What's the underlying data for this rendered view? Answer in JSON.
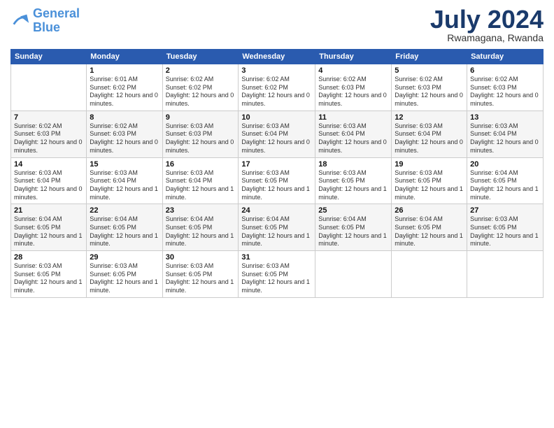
{
  "logo": {
    "line1": "General",
    "line2": "Blue"
  },
  "title": "July 2024",
  "subtitle": "Rwamagana, Rwanda",
  "days_header": [
    "Sunday",
    "Monday",
    "Tuesday",
    "Wednesday",
    "Thursday",
    "Friday",
    "Saturday"
  ],
  "weeks": [
    [
      {
        "day": "",
        "sunrise": "",
        "sunset": "",
        "daylight": ""
      },
      {
        "day": "1",
        "sunrise": "Sunrise: 6:01 AM",
        "sunset": "Sunset: 6:02 PM",
        "daylight": "Daylight: 12 hours and 0 minutes."
      },
      {
        "day": "2",
        "sunrise": "Sunrise: 6:02 AM",
        "sunset": "Sunset: 6:02 PM",
        "daylight": "Daylight: 12 hours and 0 minutes."
      },
      {
        "day": "3",
        "sunrise": "Sunrise: 6:02 AM",
        "sunset": "Sunset: 6:02 PM",
        "daylight": "Daylight: 12 hours and 0 minutes."
      },
      {
        "day": "4",
        "sunrise": "Sunrise: 6:02 AM",
        "sunset": "Sunset: 6:03 PM",
        "daylight": "Daylight: 12 hours and 0 minutes."
      },
      {
        "day": "5",
        "sunrise": "Sunrise: 6:02 AM",
        "sunset": "Sunset: 6:03 PM",
        "daylight": "Daylight: 12 hours and 0 minutes."
      },
      {
        "day": "6",
        "sunrise": "Sunrise: 6:02 AM",
        "sunset": "Sunset: 6:03 PM",
        "daylight": "Daylight: 12 hours and 0 minutes."
      }
    ],
    [
      {
        "day": "7",
        "sunrise": "Sunrise: 6:02 AM",
        "sunset": "Sunset: 6:03 PM",
        "daylight": "Daylight: 12 hours and 0 minutes."
      },
      {
        "day": "8",
        "sunrise": "Sunrise: 6:02 AM",
        "sunset": "Sunset: 6:03 PM",
        "daylight": "Daylight: 12 hours and 0 minutes."
      },
      {
        "day": "9",
        "sunrise": "Sunrise: 6:03 AM",
        "sunset": "Sunset: 6:03 PM",
        "daylight": "Daylight: 12 hours and 0 minutes."
      },
      {
        "day": "10",
        "sunrise": "Sunrise: 6:03 AM",
        "sunset": "Sunset: 6:04 PM",
        "daylight": "Daylight: 12 hours and 0 minutes."
      },
      {
        "day": "11",
        "sunrise": "Sunrise: 6:03 AM",
        "sunset": "Sunset: 6:04 PM",
        "daylight": "Daylight: 12 hours and 0 minutes."
      },
      {
        "day": "12",
        "sunrise": "Sunrise: 6:03 AM",
        "sunset": "Sunset: 6:04 PM",
        "daylight": "Daylight: 12 hours and 0 minutes."
      },
      {
        "day": "13",
        "sunrise": "Sunrise: 6:03 AM",
        "sunset": "Sunset: 6:04 PM",
        "daylight": "Daylight: 12 hours and 0 minutes."
      }
    ],
    [
      {
        "day": "14",
        "sunrise": "Sunrise: 6:03 AM",
        "sunset": "Sunset: 6:04 PM",
        "daylight": "Daylight: 12 hours and 0 minutes."
      },
      {
        "day": "15",
        "sunrise": "Sunrise: 6:03 AM",
        "sunset": "Sunset: 6:04 PM",
        "daylight": "Daylight: 12 hours and 1 minute."
      },
      {
        "day": "16",
        "sunrise": "Sunrise: 6:03 AM",
        "sunset": "Sunset: 6:04 PM",
        "daylight": "Daylight: 12 hours and 1 minute."
      },
      {
        "day": "17",
        "sunrise": "Sunrise: 6:03 AM",
        "sunset": "Sunset: 6:05 PM",
        "daylight": "Daylight: 12 hours and 1 minute."
      },
      {
        "day": "18",
        "sunrise": "Sunrise: 6:03 AM",
        "sunset": "Sunset: 6:05 PM",
        "daylight": "Daylight: 12 hours and 1 minute."
      },
      {
        "day": "19",
        "sunrise": "Sunrise: 6:03 AM",
        "sunset": "Sunset: 6:05 PM",
        "daylight": "Daylight: 12 hours and 1 minute."
      },
      {
        "day": "20",
        "sunrise": "Sunrise: 6:04 AM",
        "sunset": "Sunset: 6:05 PM",
        "daylight": "Daylight: 12 hours and 1 minute."
      }
    ],
    [
      {
        "day": "21",
        "sunrise": "Sunrise: 6:04 AM",
        "sunset": "Sunset: 6:05 PM",
        "daylight": "Daylight: 12 hours and 1 minute."
      },
      {
        "day": "22",
        "sunrise": "Sunrise: 6:04 AM",
        "sunset": "Sunset: 6:05 PM",
        "daylight": "Daylight: 12 hours and 1 minute."
      },
      {
        "day": "23",
        "sunrise": "Sunrise: 6:04 AM",
        "sunset": "Sunset: 6:05 PM",
        "daylight": "Daylight: 12 hours and 1 minute."
      },
      {
        "day": "24",
        "sunrise": "Sunrise: 6:04 AM",
        "sunset": "Sunset: 6:05 PM",
        "daylight": "Daylight: 12 hours and 1 minute."
      },
      {
        "day": "25",
        "sunrise": "Sunrise: 6:04 AM",
        "sunset": "Sunset: 6:05 PM",
        "daylight": "Daylight: 12 hours and 1 minute."
      },
      {
        "day": "26",
        "sunrise": "Sunrise: 6:04 AM",
        "sunset": "Sunset: 6:05 PM",
        "daylight": "Daylight: 12 hours and 1 minute."
      },
      {
        "day": "27",
        "sunrise": "Sunrise: 6:03 AM",
        "sunset": "Sunset: 6:05 PM",
        "daylight": "Daylight: 12 hours and 1 minute."
      }
    ],
    [
      {
        "day": "28",
        "sunrise": "Sunrise: 6:03 AM",
        "sunset": "Sunset: 6:05 PM",
        "daylight": "Daylight: 12 hours and 1 minute."
      },
      {
        "day": "29",
        "sunrise": "Sunrise: 6:03 AM",
        "sunset": "Sunset: 6:05 PM",
        "daylight": "Daylight: 12 hours and 1 minute."
      },
      {
        "day": "30",
        "sunrise": "Sunrise: 6:03 AM",
        "sunset": "Sunset: 6:05 PM",
        "daylight": "Daylight: 12 hours and 1 minute."
      },
      {
        "day": "31",
        "sunrise": "Sunrise: 6:03 AM",
        "sunset": "Sunset: 6:05 PM",
        "daylight": "Daylight: 12 hours and 1 minute."
      },
      {
        "day": "",
        "sunrise": "",
        "sunset": "",
        "daylight": ""
      },
      {
        "day": "",
        "sunrise": "",
        "sunset": "",
        "daylight": ""
      },
      {
        "day": "",
        "sunrise": "",
        "sunset": "",
        "daylight": ""
      }
    ]
  ]
}
